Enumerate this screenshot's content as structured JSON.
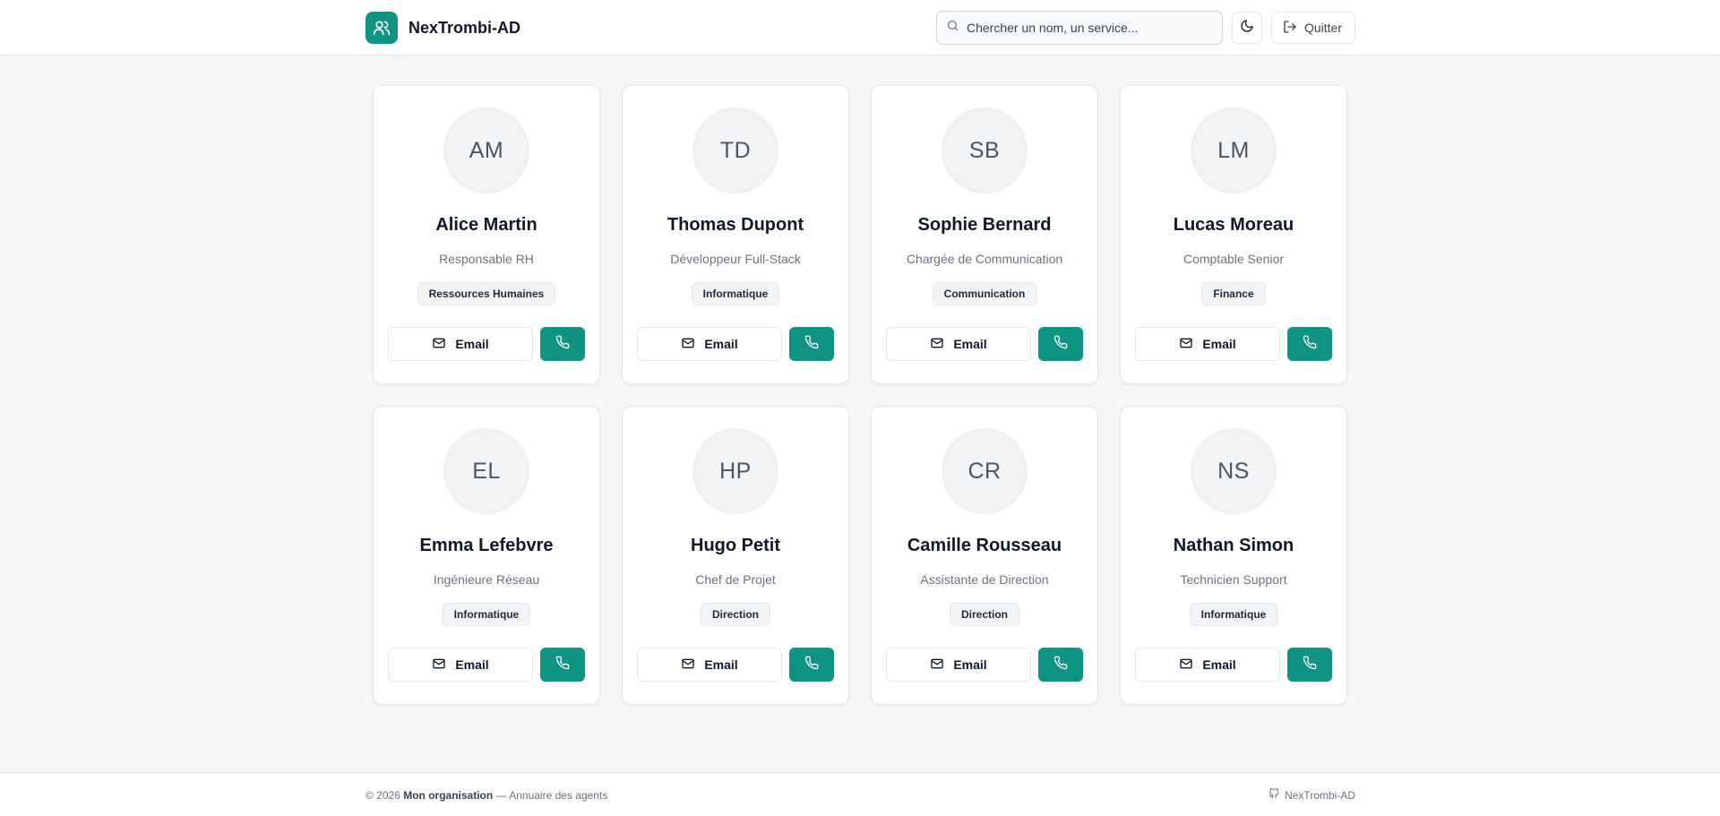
{
  "app": {
    "name": "NexTrombi-AD",
    "search_placeholder": "Chercher un nom, un service...",
    "quit_label": "Quitter"
  },
  "people": [
    {
      "initials": "AM",
      "name": "Alice Martin",
      "role": "Responsable RH",
      "department": "Ressources Humaines",
      "email_label": "Email"
    },
    {
      "initials": "TD",
      "name": "Thomas Dupont",
      "role": "Développeur Full-Stack",
      "department": "Informatique",
      "email_label": "Email"
    },
    {
      "initials": "SB",
      "name": "Sophie Bernard",
      "role": "Chargée de Communication",
      "department": "Communication",
      "email_label": "Email"
    },
    {
      "initials": "LM",
      "name": "Lucas Moreau",
      "role": "Comptable Senior",
      "department": "Finance",
      "email_label": "Email"
    },
    {
      "initials": "EL",
      "name": "Emma Lefebvre",
      "role": "Ingénieure Réseau",
      "department": "Informatique",
      "email_label": "Email"
    },
    {
      "initials": "HP",
      "name": "Hugo Petit",
      "role": "Chef de Projet",
      "department": "Direction",
      "email_label": "Email"
    },
    {
      "initials": "CR",
      "name": "Camille Rousseau",
      "role": "Assistante de Direction",
      "department": "Direction",
      "email_label": "Email"
    },
    {
      "initials": "NS",
      "name": "Nathan Simon",
      "role": "Technicien Support",
      "department": "Informatique",
      "email_label": "Email"
    }
  ],
  "footer": {
    "copyright": "© 2026",
    "organization": "Mon organisation",
    "tagline": "— Annuaire des agents",
    "brand": "NexTrombi-AD"
  },
  "colors": {
    "accent": "#0f9483",
    "background": "#f6f7f9"
  },
  "icons": {
    "logo": "users-icon",
    "search": "search-icon",
    "theme": "moon-icon",
    "quit": "logout-icon",
    "email": "mail-icon",
    "phone": "phone-icon",
    "footer": "github-icon"
  }
}
